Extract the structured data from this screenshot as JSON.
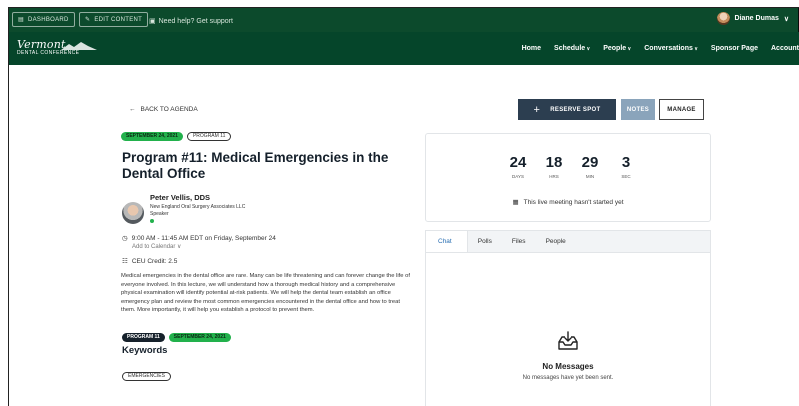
{
  "admin_bar": {
    "dashboard_label": "Dashboard",
    "edit_content_label": "Edit Content",
    "support_label": "Need help? Get support",
    "user_name": "Diane Dumas"
  },
  "nav": {
    "logo_line1": "Vermont",
    "logo_line2": "DENTAL CONFERENCE",
    "items": [
      "Home",
      "Schedule",
      "People",
      "Conversations",
      "Sponsor Page",
      "Account"
    ]
  },
  "session": {
    "back_label": "BACK TO AGENDA",
    "date_badge": "SEPTEMBER 24, 2021",
    "program_badge": "PROGRAM 11",
    "title": "Program #11: Medical Emergencies in the Dental Office",
    "speaker": {
      "name": "Peter Vellis, DDS",
      "org": "New England Oral Surgery Associates LLC",
      "role": "Speaker"
    },
    "time": "9:00 AM - 11:45 AM EDT on Friday, September 24",
    "add_to_calendar": "Add to Calendar",
    "ceu": "CEU Credit: 2.5",
    "description": "Medical emergencies in the dental office are rare. Many can be life threatening and can forever change the life of everyone involved. In this lecture, we will understand how a thorough medical history and a comprehensive physical examination will identify potential at-risk patients. We will help the dental team establish an office emergency plan and review the most common emergencies encountered in the dental office and how to treat them. More importantly, it will help you establish a protocol to prevent them.",
    "tag_program": "PROGRAM 11",
    "tag_date": "SEPTEMBER 24, 2021",
    "keywords_heading": "Keywords",
    "keywords": [
      "EMERGENCIES"
    ]
  },
  "actions": {
    "reserve_label": "RESERVE SPOT",
    "notes_label": "NOTES",
    "manage_label": "MANAGE"
  },
  "countdown": {
    "days": "24",
    "days_label": "DAYS",
    "hours": "18",
    "hours_label": "HRS",
    "minutes": "29",
    "minutes_label": "MIN",
    "seconds": "3",
    "seconds_label": "SEC",
    "message": "This live meeting hasn't started yet"
  },
  "chat": {
    "tabs": [
      "Chat",
      "Polls",
      "Files",
      "People"
    ],
    "empty_title": "No Messages",
    "empty_subtitle": "No messages have yet been sent."
  },
  "colors": {
    "admin_bar": "#0c4a2c",
    "nav_bar": "#05452a",
    "badge_green": "#22b14c",
    "reserve_button": "#2c3e50",
    "notes_button": "#8aa4bb"
  }
}
